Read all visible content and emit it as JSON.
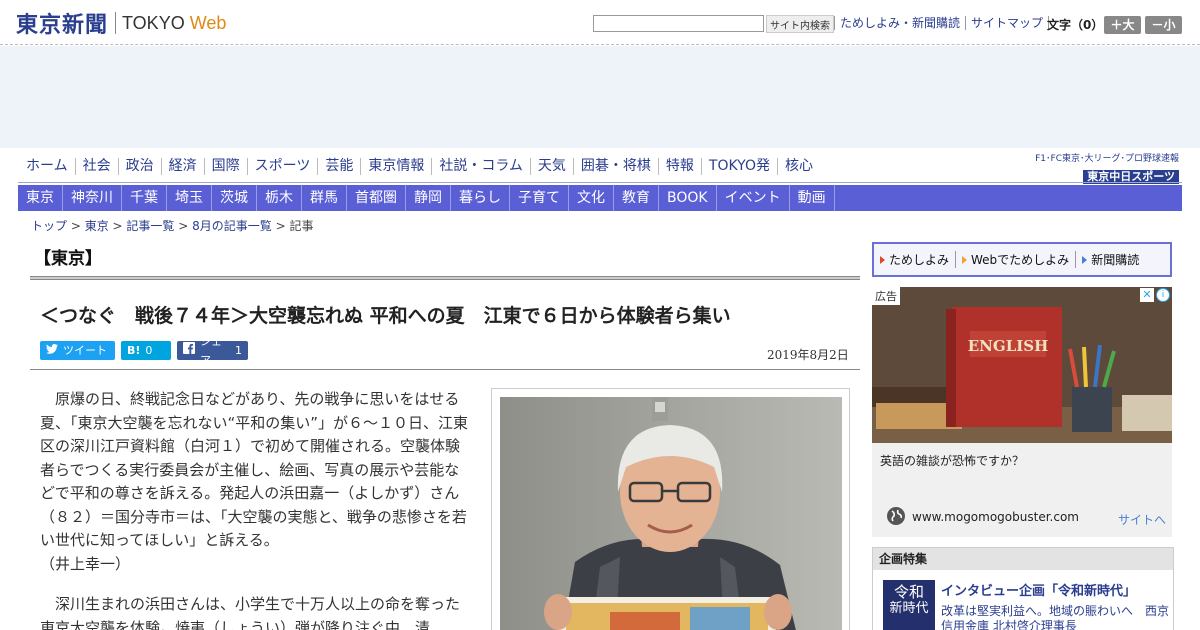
{
  "header": {
    "logo_jp": "東京新聞",
    "logo_en": "TOKYO",
    "logo_web": "Web",
    "search_placeholder": "",
    "search_button": "サイト内検索",
    "links": [
      "ためしよみ・新聞購読",
      "サイトマップ"
    ],
    "font_size_label": "文字（0）",
    "font_bigger": "＋大",
    "font_smaller": "－小"
  },
  "nav_primary": [
    "ホーム",
    "社会",
    "政治",
    "経済",
    "国際",
    "スポーツ",
    "芸能",
    "東京情報",
    "社説・コラム",
    "天気",
    "囲碁・将棋",
    "特報",
    "TOKYO発",
    "核心"
  ],
  "promo": {
    "small": "F1･FC東京･大リーグ･プロ野球速報",
    "big": "東京中日スポーツ"
  },
  "nav_secondary": [
    "東京",
    "神奈川",
    "千葉",
    "埼玉",
    "茨城",
    "栃木",
    "群馬",
    "首都圏",
    "静岡",
    "暮らし",
    "子育て",
    "文化",
    "教育",
    "BOOK",
    "イベント",
    "動画"
  ],
  "breadcrumb": {
    "items": [
      "トップ",
      "東京",
      "記事一覧",
      "8月の記事一覧"
    ],
    "separator": " > ",
    "current": "記事"
  },
  "article": {
    "section": "【東京】",
    "headline": "＜つなぐ　戦後７４年＞大空襲忘れぬ 平和への夏　江東で６日から体験者ら集い",
    "date": "2019年8月2日",
    "share": {
      "tweet_label": "ツイート",
      "hatena_label": "B!",
      "hatena_count": "0",
      "facebook_label": "シェア",
      "facebook_count": "1"
    },
    "paragraph1": "原爆の日、終戦記念日などがあり、先の戦争に思いをはせる夏、「東京大空襲を忘れない“平和の集い”」が６～１０日、江東区の深川江戸資料館（白河１）で初めて開催される。空襲体験者らでつくる実行委員会が主催し、絵画、写真の展示や芸能などで平和の尊さを訴える。発起人の浜田嘉一（よしかず）さん（８２）＝国分寺市＝は、「大空襲の実態と、戦争の悲惨さを若い世代に知ってほしい」と訴える。",
    "byline": "（井上幸一）",
    "paragraph2": "深川生まれの浜田さんは、小学生で十万人以上の命を奪った東京大空襲を体験。焼夷（しょうい）弾が降り注ぐ中、清"
  },
  "sidebar": {
    "subscribe": [
      "ためしよみ",
      "Webでためしよみ",
      "新聞購読"
    ],
    "ad": {
      "label": "広告",
      "image_text": "ENGLISH",
      "title": "英語の雑談が恐怖ですか？",
      "url": "www.mogomogobuster.com",
      "link": "サイトへ"
    },
    "feature": {
      "heading": "企画特集",
      "thumb_line1": "令和",
      "thumb_line2": "新時代",
      "title": "インタビュー企画「令和新時代」",
      "desc": "改革は堅実利益へ。地域の賑わいへ　西京信用金庫 北村啓介理事長"
    }
  },
  "colors": {
    "brand_navy": "#2b3f8f",
    "nav_purple": "#5b5fd6",
    "link_blue": "#2a3d8f",
    "twitter": "#1da1f2",
    "hatena": "#00a4de",
    "facebook": "#3b5998"
  }
}
